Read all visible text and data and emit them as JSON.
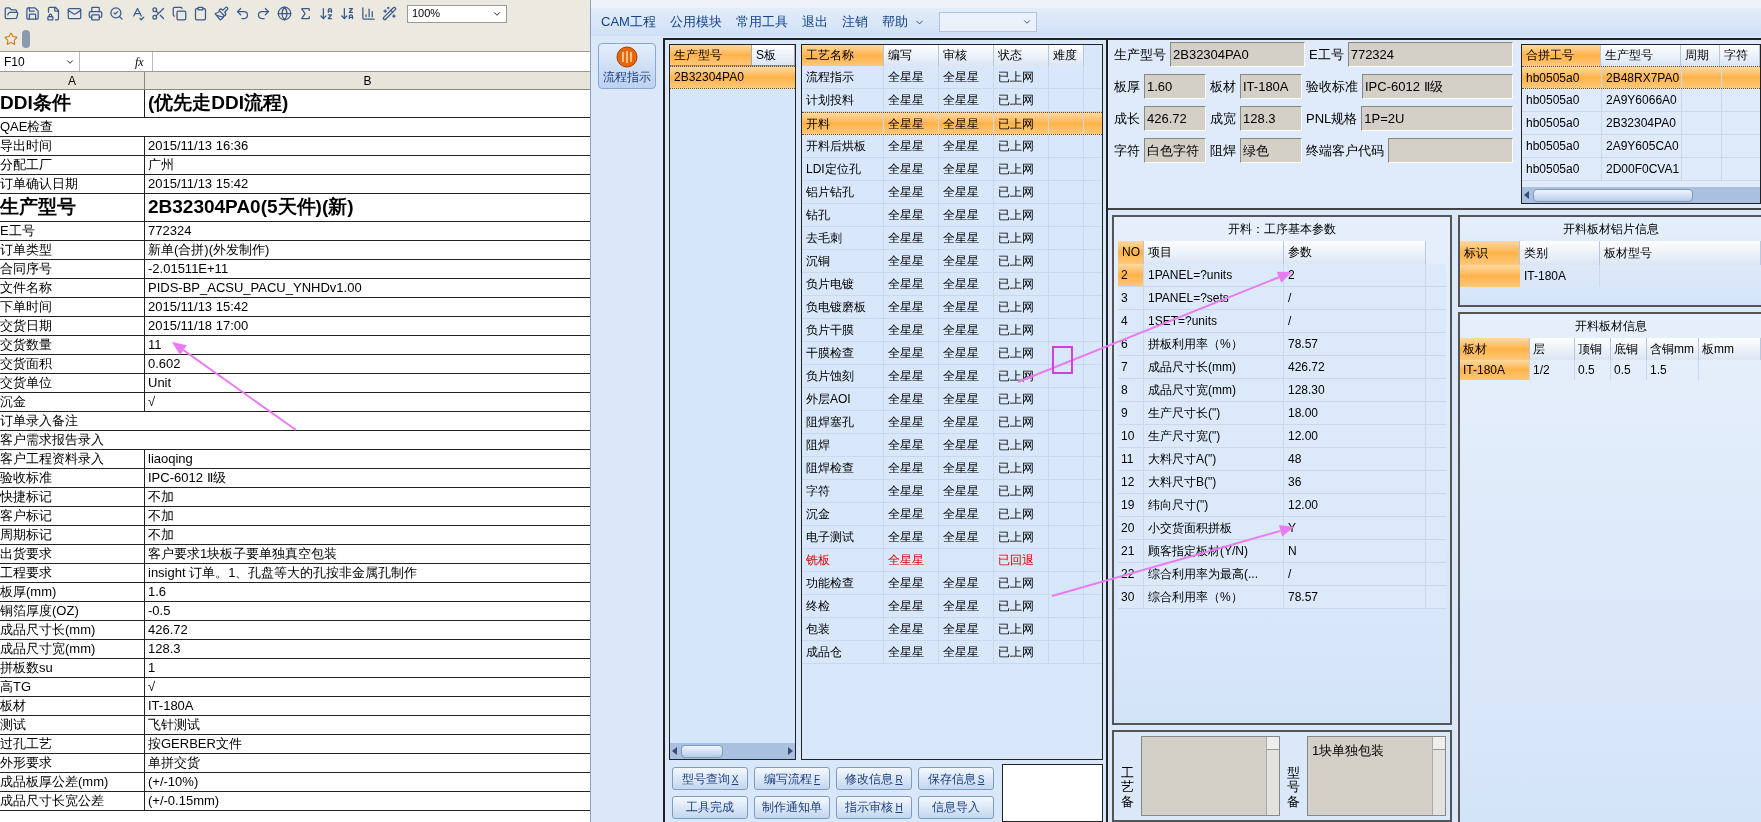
{
  "spreadsheet": {
    "zoom": "100%",
    "name_box": "F10",
    "formula_label": "fx",
    "columns": [
      "A",
      "B"
    ],
    "rows": [
      {
        "kind": "big",
        "label": "DDI条件",
        "value": "(优先走DDI流程)"
      },
      {
        "kind": "wide",
        "label": "QAE检查"
      },
      {
        "kind": "normal",
        "label": "导出时间",
        "value": "2015/11/13 16:36"
      },
      {
        "kind": "normal",
        "label": "分配工厂",
        "value": "广州"
      },
      {
        "kind": "normal",
        "label": "订单确认日期",
        "value": "2015/11/13 15:42"
      },
      {
        "kind": "big",
        "label": "生产型号",
        "value": "2B32304PA0(5天件)(新)"
      },
      {
        "kind": "normal",
        "label": "E工号",
        "value": "772324"
      },
      {
        "kind": "normal",
        "label": "订单类型",
        "value": "新单(合拼)(外发制作)"
      },
      {
        "kind": "normal",
        "label": "合同序号",
        "value": "-2.01511E+11"
      },
      {
        "kind": "normal",
        "label": "文件名称",
        "value": "PIDS-BP_ACSU_PACU_YNHDv1.00"
      },
      {
        "kind": "normal",
        "label": "下单时间",
        "value": "2015/11/13 15:42"
      },
      {
        "kind": "normal",
        "label": "交货日期",
        "value": "2015/11/18 17:00"
      },
      {
        "kind": "normal",
        "label": "交货数量",
        "value": "11"
      },
      {
        "kind": "normal",
        "label": "交货面积",
        "value": "0.602"
      },
      {
        "kind": "normal",
        "label": "交货单位",
        "value": "Unit"
      },
      {
        "kind": "normal",
        "label": "沉金",
        "value": "√"
      },
      {
        "kind": "wide",
        "label": "订单录入备注"
      },
      {
        "kind": "wide",
        "label": "客户需求报告录入"
      },
      {
        "kind": "normal",
        "label": "客户工程资料录入",
        "value": "liaoqing"
      },
      {
        "kind": "normal",
        "label": "验收标准",
        "value": "IPC-6012 Ⅱ级"
      },
      {
        "kind": "normal",
        "label": "快捷标记",
        "value": "不加"
      },
      {
        "kind": "normal",
        "label": "客户标记",
        "value": "不加"
      },
      {
        "kind": "normal",
        "label": "周期标记",
        "value": "不加"
      },
      {
        "kind": "normal",
        "label": "出货要求",
        "value": "客户要求1块板子要单独真空包装"
      },
      {
        "kind": "normal",
        "label": "工程要求",
        "value": "insight 订单。1、孔盘等大的孔按非金属孔制作"
      },
      {
        "kind": "normal",
        "label": "板厚(mm)",
        "value": "1.6"
      },
      {
        "kind": "normal",
        "label": "铜箔厚度(OZ)",
        "value": "-0.5"
      },
      {
        "kind": "normal",
        "label": "成品尺寸长(mm)",
        "value": "426.72"
      },
      {
        "kind": "normal",
        "label": "成品尺寸宽(mm)",
        "value": "128.3"
      },
      {
        "kind": "normal",
        "label": "拼板数su",
        "value": "1"
      },
      {
        "kind": "normal",
        "label": "高TG",
        "value": "√"
      },
      {
        "kind": "normal",
        "label": "板材",
        "value": "IT-180A"
      },
      {
        "kind": "normal",
        "label": "测试",
        "value": "飞针测试"
      },
      {
        "kind": "normal",
        "label": "过孔工艺",
        "value": "按GERBER文件"
      },
      {
        "kind": "normal",
        "label": "外形要求",
        "value": "单拼交货"
      },
      {
        "kind": "normal",
        "label": "成品板厚公差(mm)",
        "value": "(+/-10%)"
      },
      {
        "kind": "normal",
        "label": "成品尺寸长宽公差",
        "value": "(+/-0.15mm)"
      }
    ]
  },
  "menu": [
    "CAM工程",
    "公用模块",
    "常用工具",
    "退出",
    "注销",
    "帮助"
  ],
  "nav_button": "流程指示",
  "model_list": {
    "columns": [
      "生产型号",
      "S板"
    ],
    "rows": [
      {
        "value": "2B32304PA0",
        "selected": true
      }
    ]
  },
  "process_table": {
    "columns": [
      "工艺名称",
      "编写",
      "审核",
      "状态",
      "难度"
    ],
    "rows": [
      {
        "name": "流程指示",
        "writer": "全星星",
        "reviewer": "全星星",
        "status": "已上网",
        "selected": false,
        "rejected": false
      },
      {
        "name": "计划投料",
        "writer": "全星星",
        "reviewer": "全星星",
        "status": "已上网",
        "selected": false,
        "rejected": false
      },
      {
        "name": "开料",
        "writer": "全星星",
        "reviewer": "全星星",
        "status": "已上网",
        "selected": true,
        "rejected": false
      },
      {
        "name": "开料后烘板",
        "writer": "全星星",
        "reviewer": "全星星",
        "status": "已上网",
        "selected": false,
        "rejected": false
      },
      {
        "name": "LDI定位孔",
        "writer": "全星星",
        "reviewer": "全星星",
        "status": "已上网",
        "selected": false,
        "rejected": false
      },
      {
        "name": "铝片钻孔",
        "writer": "全星星",
        "reviewer": "全星星",
        "status": "已上网",
        "selected": false,
        "rejected": false
      },
      {
        "name": "钻孔",
        "writer": "全星星",
        "reviewer": "全星星",
        "status": "已上网",
        "selected": false,
        "rejected": false
      },
      {
        "name": "去毛刺",
        "writer": "全星星",
        "reviewer": "全星星",
        "status": "已上网",
        "selected": false,
        "rejected": false
      },
      {
        "name": "沉铜",
        "writer": "全星星",
        "reviewer": "全星星",
        "status": "已上网",
        "selected": false,
        "rejected": false
      },
      {
        "name": "负片电镀",
        "writer": "全星星",
        "reviewer": "全星星",
        "status": "已上网",
        "selected": false,
        "rejected": false
      },
      {
        "name": "负电镀磨板",
        "writer": "全星星",
        "reviewer": "全星星",
        "status": "已上网",
        "selected": false,
        "rejected": false
      },
      {
        "name": "负片干膜",
        "writer": "全星星",
        "reviewer": "全星星",
        "status": "已上网",
        "selected": false,
        "rejected": false
      },
      {
        "name": "干膜检查",
        "writer": "全星星",
        "reviewer": "全星星",
        "status": "已上网",
        "selected": false,
        "rejected": false
      },
      {
        "name": "负片蚀刻",
        "writer": "全星星",
        "reviewer": "全星星",
        "status": "已上网",
        "selected": false,
        "rejected": false
      },
      {
        "name": "外层AOI",
        "writer": "全星星",
        "reviewer": "全星星",
        "status": "已上网",
        "selected": false,
        "rejected": false
      },
      {
        "name": "阻焊塞孔",
        "writer": "全星星",
        "reviewer": "全星星",
        "status": "已上网",
        "selected": false,
        "rejected": false
      },
      {
        "name": "阻焊",
        "writer": "全星星",
        "reviewer": "全星星",
        "status": "已上网",
        "selected": false,
        "rejected": false
      },
      {
        "name": "阻焊检查",
        "writer": "全星星",
        "reviewer": "全星星",
        "status": "已上网",
        "selected": false,
        "rejected": false
      },
      {
        "name": "字符",
        "writer": "全星星",
        "reviewer": "全星星",
        "status": "已上网",
        "selected": false,
        "rejected": false
      },
      {
        "name": "沉金",
        "writer": "全星星",
        "reviewer": "全星星",
        "status": "已上网",
        "selected": false,
        "rejected": false
      },
      {
        "name": "电子测试",
        "writer": "全星星",
        "reviewer": "全星星",
        "status": "已上网",
        "selected": false,
        "rejected": false
      },
      {
        "name": "铣板",
        "writer": "全星星",
        "status": "已回退",
        "selected": false,
        "rejected": true
      },
      {
        "name": "功能检查",
        "writer": "全星星",
        "reviewer": "全星星",
        "status": "已上网",
        "selected": false,
        "rejected": false
      },
      {
        "name": "终检",
        "writer": "全星星",
        "reviewer": "全星星",
        "status": "已上网",
        "selected": false,
        "rejected": false
      },
      {
        "name": "包装",
        "writer": "全星星",
        "reviewer": "全星星",
        "status": "已上网",
        "selected": false,
        "rejected": false
      },
      {
        "name": "成品仓",
        "writer": "全星星",
        "reviewer": "全星星",
        "status": "已上网",
        "selected": false,
        "rejected": false
      }
    ]
  },
  "buttons": [
    {
      "label": "型号查询",
      "key": "X"
    },
    {
      "label": "编写流程",
      "key": "F"
    },
    {
      "label": "修改信息",
      "key": "R"
    },
    {
      "label": "保存信息",
      "key": "S"
    },
    {
      "label": "工具完成"
    },
    {
      "label": "制作通知单"
    },
    {
      "label": "指示审核",
      "key": "H"
    },
    {
      "label": "信息导入"
    }
  ],
  "info_rows": [
    [
      {
        "label": "生产型号",
        "value": "2B32304PA0"
      },
      {
        "label": "E工号",
        "value": "772324"
      }
    ],
    [
      {
        "label": "板厚",
        "value": "1.60"
      },
      {
        "label": "板材",
        "value": "IT-180A"
      },
      {
        "label": "验收标准",
        "value": "IPC-6012 Ⅱ级"
      }
    ],
    [
      {
        "label": "成长",
        "value": "426.72"
      },
      {
        "label": "成宽",
        "value": "128.3"
      },
      {
        "label": "PNL规格",
        "value": "1P=2U"
      }
    ],
    [
      {
        "label": "字符",
        "value": "白色字符"
      },
      {
        "label": "阻焊",
        "value": "绿色"
      },
      {
        "label": "终端客户代码"
      }
    ]
  ],
  "merge_table": {
    "columns": [
      "合拼工号",
      "生产型号",
      "周期",
      "字符"
    ],
    "rows": [
      {
        "job": "hb0505a0",
        "model": "2B48RX7PA0",
        "selected": true
      },
      {
        "job": "hb0505a0",
        "model": "2A9Y6066A0",
        "selected": false
      },
      {
        "job": "hb0505a0",
        "model": "2B32304PA0",
        "selected": false
      },
      {
        "job": "hb0505a0",
        "model": "2A9Y605CA0",
        "selected": false
      },
      {
        "job": "hb0505a0",
        "model": "2D00F0CVA1",
        "selected": false
      }
    ]
  },
  "params_panel": {
    "title": "开料：工序基本参数",
    "columns": [
      "NO",
      "项目",
      "参数"
    ],
    "rows": [
      {
        "no": "2",
        "item": "1PANEL=?units",
        "value": "2",
        "selected": true
      },
      {
        "no": "3",
        "item": "1PANEL=?sets",
        "value": "/",
        "selected": false
      },
      {
        "no": "4",
        "item": "1SET=?units",
        "value": "/",
        "selected": false
      },
      {
        "no": "6",
        "item": "拼板利用率（%）",
        "value": "78.57",
        "selected": false
      },
      {
        "no": "7",
        "item": "成品尺寸长(mm)",
        "value": "426.72",
        "selected": false
      },
      {
        "no": "8",
        "item": "成品尺寸宽(mm)",
        "value": "128.30",
        "selected": false
      },
      {
        "no": "9",
        "item": "生产尺寸长(\")",
        "value": "18.00",
        "selected": false
      },
      {
        "no": "10",
        "item": "生产尺寸宽(\")",
        "value": "12.00",
        "selected": false
      },
      {
        "no": "11",
        "item": "大料尺寸A(\")",
        "value": "48",
        "selected": false
      },
      {
        "no": "12",
        "item": "大料尺寸B(\")",
        "value": "36",
        "selected": false
      },
      {
        "no": "19",
        "item": "纬向尺寸(\")",
        "value": "12.00",
        "selected": false
      },
      {
        "no": "20",
        "item": "小交货面积拼板",
        "value": "Y",
        "selected": false
      },
      {
        "no": "21",
        "item": "顾客指定板材(Y/N)",
        "value": "N",
        "selected": false
      },
      {
        "no": "22",
        "item": "综合利用率为最高(...",
        "value": "/",
        "selected": false
      },
      {
        "no": "30",
        "item": "综合利用率（%）",
        "value": "78.57",
        "selected": false
      }
    ]
  },
  "remarks": [
    {
      "label": "工艺备"
    },
    {
      "label": "型号备",
      "text": "1块单独包装"
    }
  ],
  "foil_panel": {
    "title": "开料板材铝片信息",
    "columns": [
      "标识",
      "类别",
      "板材型号"
    ],
    "rows": [
      {
        "category": "IT-180A",
        "selected": true
      }
    ]
  },
  "board_panel": {
    "title": "开料板材信息",
    "columns": [
      "板材",
      "层",
      "顶铜",
      "底铜",
      "含铜mm",
      "板mm"
    ],
    "rows": [
      {
        "cells": [
          "IT-180A",
          "1/2",
          "0.5",
          "0.5",
          "1.5"
        ],
        "selected": true
      }
    ]
  }
}
